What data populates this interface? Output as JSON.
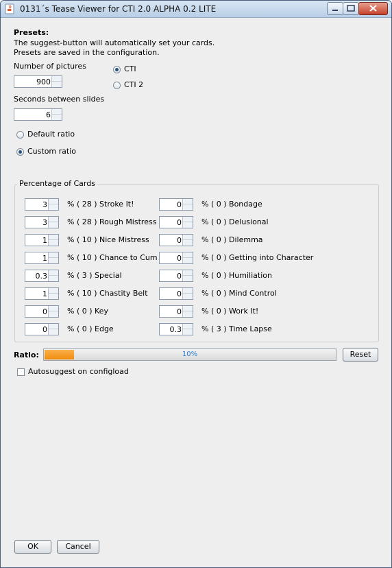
{
  "window": {
    "title": "0131´s Tease Viewer for CTI 2.0 ALPHA 0.2 LITE",
    "accent": "#f28c0e"
  },
  "presets": {
    "heading": "Presets:",
    "line1": "The suggest-button will automatically set your cards.",
    "line2": "Presets are saved in the configuration.",
    "num_pictures_label": "Number of pictures",
    "num_pictures_value": "900",
    "seconds_label": "Seconds between slides",
    "seconds_value": "6",
    "mode_options": [
      {
        "label": "CTI",
        "selected": true
      },
      {
        "label": "CTI 2",
        "selected": false
      }
    ],
    "ratio_options": [
      {
        "label": "Default ratio",
        "selected": false
      },
      {
        "label": "Custom ratio",
        "selected": true
      }
    ]
  },
  "cards": {
    "group_title": "Percentage of Cards",
    "left": [
      {
        "value": "3",
        "label": "% ( 28 ) Stroke It!"
      },
      {
        "value": "3",
        "label": "% ( 28 ) Rough Mistress"
      },
      {
        "value": "1",
        "label": "% ( 10 ) Nice Mistress"
      },
      {
        "value": "1",
        "label": "% ( 10 ) Chance to Cum"
      },
      {
        "value": "0.3",
        "label": "% ( 3 ) Special"
      },
      {
        "value": "1",
        "label": "% ( 10 ) Chastity Belt"
      },
      {
        "value": "0",
        "label": "% ( 0 ) Key"
      },
      {
        "value": "0",
        "label": "% ( 0 ) Edge"
      }
    ],
    "right": [
      {
        "value": "0",
        "label": "% ( 0 ) Bondage"
      },
      {
        "value": "0",
        "label": "% ( 0 ) Delusional"
      },
      {
        "value": "0",
        "label": "% ( 0 ) Dilemma"
      },
      {
        "value": "0",
        "label": "% ( 0 ) Getting into Character"
      },
      {
        "value": "0",
        "label": "% ( 0 ) Humiliation"
      },
      {
        "value": "0",
        "label": "% ( 0 ) Mind Control"
      },
      {
        "value": "0",
        "label": "% ( 0 ) Work It!"
      },
      {
        "value": "0.3",
        "label": "% ( 3 ) Time Lapse"
      }
    ]
  },
  "ratio": {
    "label": "Ratio:",
    "progress_text": "10%",
    "progress_fraction": 0.1,
    "reset_label": "Reset"
  },
  "autosuggest": {
    "label": "Autosuggest on configload",
    "checked": false
  },
  "footer": {
    "ok_label": "OK",
    "cancel_label": "Cancel"
  }
}
